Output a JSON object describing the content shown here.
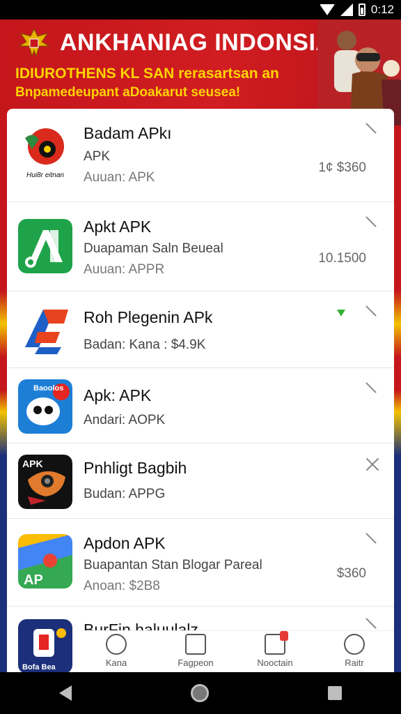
{
  "status_bar": {
    "time": "0:12"
  },
  "banner": {
    "title": "ANKHANIAG INDONSIA",
    "subtitle1": "IDIUROTHENS KL SAN rerasartsan an",
    "subtitle2": "Bnpamedeupant aDoakarut seusea!"
  },
  "apps": [
    {
      "name": "Badam APkı",
      "line1": "APK",
      "line2": "Auuan: APK",
      "price": "1¢ $360",
      "icon_caption": "Hui8r eitnan"
    },
    {
      "name": "Apkt APK",
      "line1": "Duapaman Saln Beueal",
      "line2": "Auuan: APPR",
      "price": "10.1500"
    },
    {
      "name": "Roh Plegenin APk",
      "line1": "Badan: Kana : $4.9K",
      "line2": "",
      "price": ""
    },
    {
      "name": "Apk: APK",
      "line1": "Andari: AOPK",
      "line2": "",
      "price": "",
      "icon_caption": "Baoolos"
    },
    {
      "name": "Pnhligt Bagbih",
      "line1": "Budan: APPG",
      "line2": "",
      "price": "",
      "icon_caption": "APK"
    },
    {
      "name": "Apdon APK",
      "line1": "Buapantan Stan Blogar Pareal",
      "line2": "Anoan: $2B8",
      "price": "$360"
    },
    {
      "name": "BurFin haluulalz",
      "line1": "",
      "line2": "",
      "price": "",
      "icon_caption": "Bofa Bea"
    }
  ],
  "bottom_nav": [
    {
      "label": "Kana",
      "icon": "network-icon"
    },
    {
      "label": "Fagpeon",
      "icon": "package-icon"
    },
    {
      "label": "Nooctain",
      "icon": "notification-icon"
    },
    {
      "label": "Raitr",
      "icon": "profile-icon"
    }
  ],
  "colors": {
    "banner_red": "#c4161c",
    "banner_yellow": "#ffd400",
    "indonesia_blue": "#1b2f7a"
  }
}
